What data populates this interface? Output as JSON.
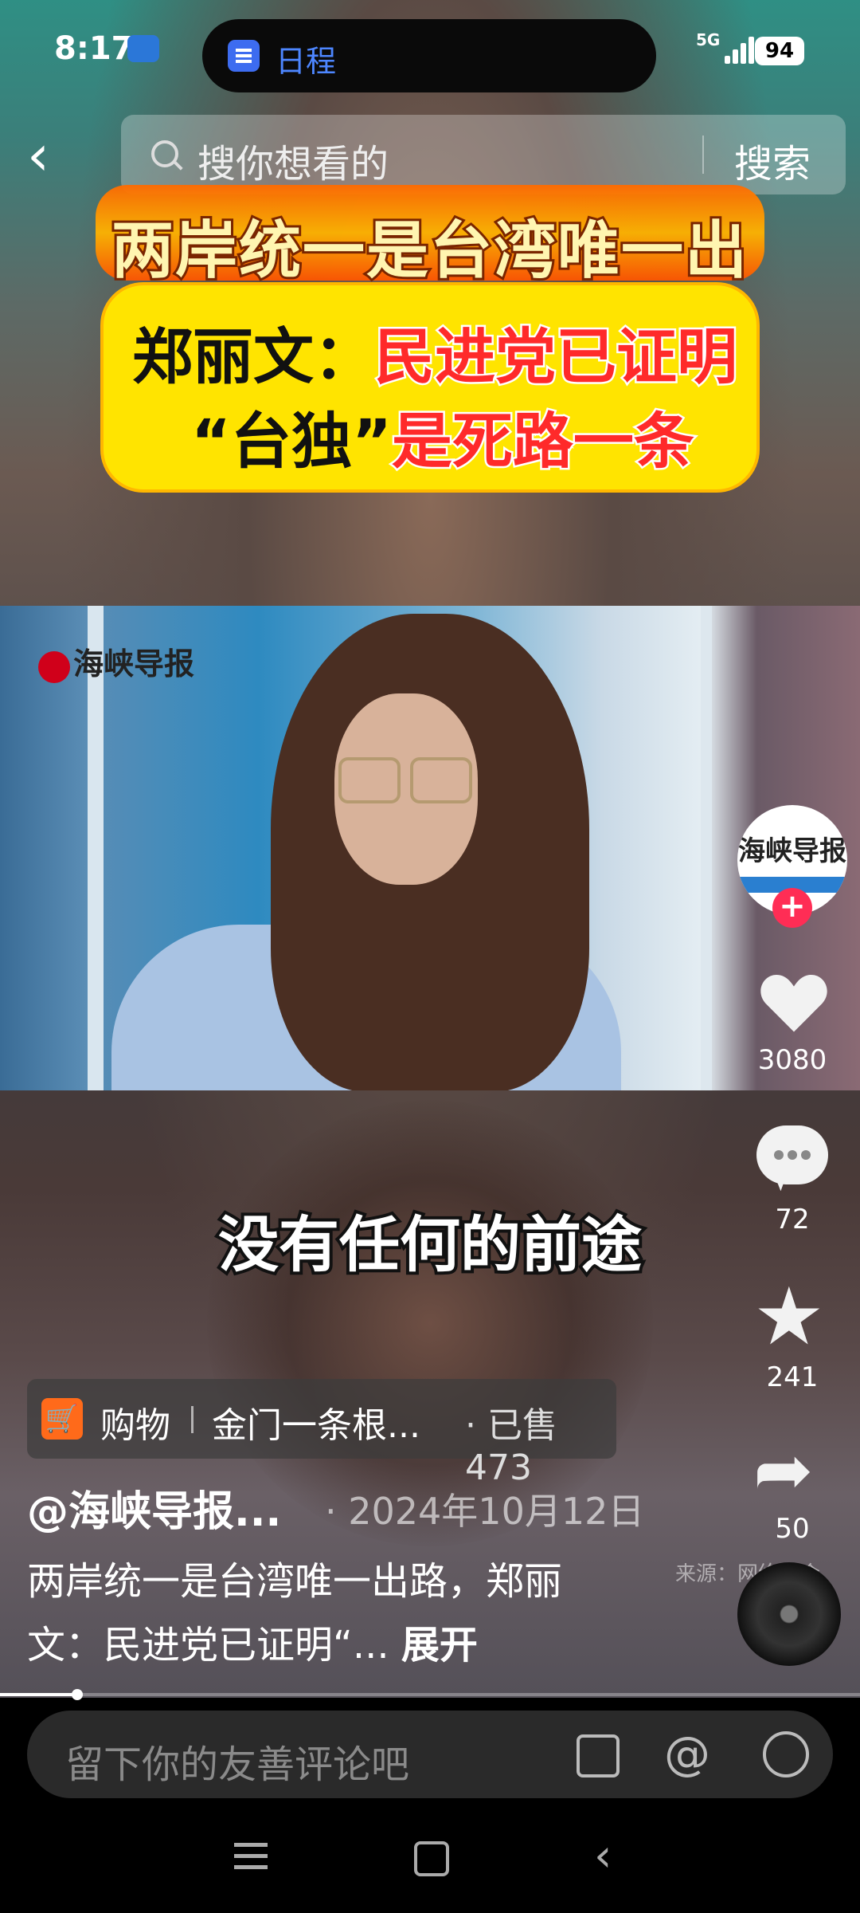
{
  "status_bar": {
    "time": "8:17",
    "island_label": "日程",
    "network": "5G",
    "battery": "94"
  },
  "search": {
    "placeholder": "搜你想看的",
    "button": "搜索"
  },
  "video": {
    "banner_title": "两岸统一是台湾唯一出路",
    "box_line1_speaker": "郑丽文：",
    "box_line1_red": "民进党已证明",
    "box_line2_black": "“台独”",
    "box_line2_red": "是死路一条",
    "channel_logo": "海峡导报",
    "subtitle": "没有任何的前途"
  },
  "rail": {
    "avatar_text": "海峡导报",
    "follow": "+",
    "likes": "3080",
    "comments": "72",
    "favorites": "241",
    "shares": "50"
  },
  "shop": {
    "label": "购物",
    "product": "金门一条根...",
    "sold": "· 已售473"
  },
  "post": {
    "author": "@海峡导报...",
    "date": "· 2024年10月12日",
    "description": "两岸统一是台湾唯一出路，郑丽文：民进党已证明“...",
    "expand": "展开",
    "source": "来源：网络综合"
  },
  "progress": {
    "fraction": 0.09
  },
  "comment_bar": {
    "placeholder": "留下你的友善评论吧"
  }
}
